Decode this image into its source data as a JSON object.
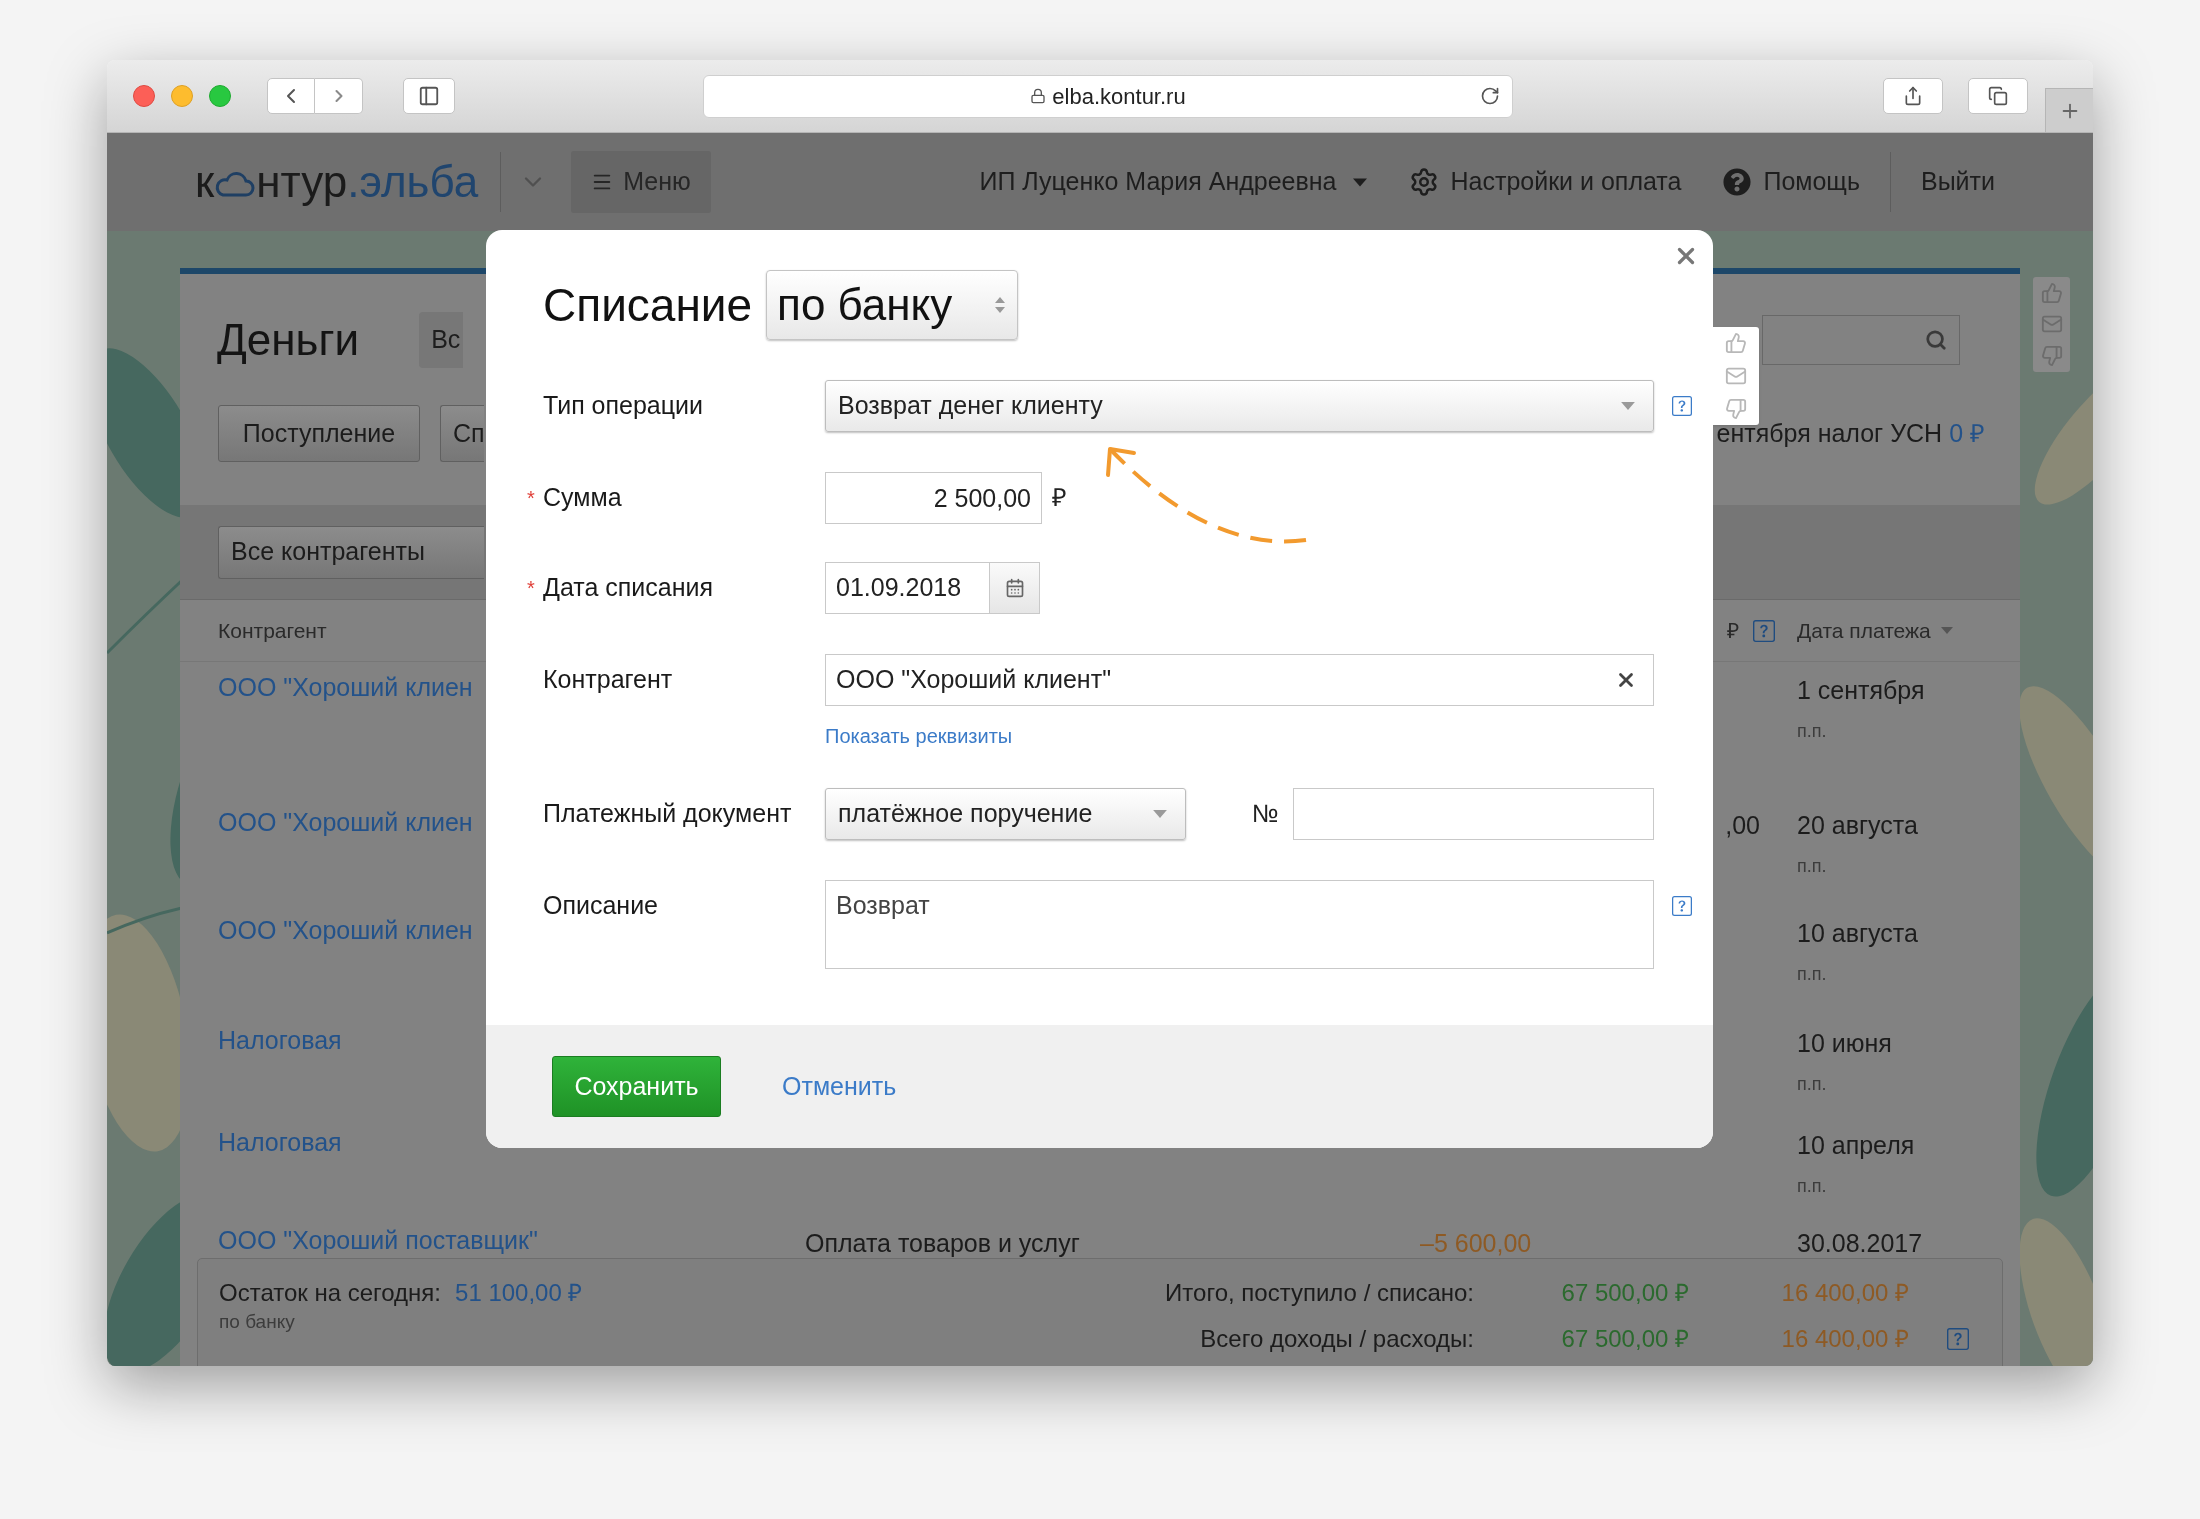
{
  "browser": {
    "url": "elba.kontur.ru"
  },
  "header": {
    "logo": {
      "first": "к",
      "middle": "нтур",
      "last": ".эльба"
    },
    "menu": "Меню",
    "user": "ИП Луценко Мария Андреевна",
    "settings": "Настройки и оплата",
    "help": "Помощь",
    "logout": "Выйти"
  },
  "page": {
    "title": "Деньги",
    "view_tab": "Вс",
    "buttons": [
      "Поступление",
      "Сп"
    ],
    "tax_note": {
      "text": "ентября налог УСН",
      "amount": "0 ₽"
    },
    "filter": "Все контрагенты",
    "table": {
      "columns": [
        {
          "label": "Контрагент",
          "help": false,
          "sorted": false
        },
        {
          "label": "₽",
          "help": true,
          "sorted": false
        },
        {
          "label": "Дата платежа",
          "help": false,
          "sorted": true
        }
      ],
      "rows": [
        {
          "contractor": "ООО \"Хороший клиен",
          "date": "1 сентября",
          "doc": "п.п."
        },
        {
          "contractor": "ООО \"Хороший клиен",
          "income": ",00",
          "date": "20 августа",
          "doc": "п.п."
        },
        {
          "contractor": "ООО \"Хороший клиен",
          "date": "10 августа",
          "doc": "п.п."
        },
        {
          "contractor": "Налоговая",
          "date": "10 июня",
          "doc": "п.п."
        },
        {
          "contractor": "Налоговая",
          "date": "10 апреля",
          "doc": "п.п."
        },
        {
          "contractor": "ООО \"Хороший поставщик\"",
          "purpose": "Оплата товаров и услуг",
          "expense": "–5 600,00",
          "date": "30.08.2017"
        }
      ]
    },
    "summary": {
      "balance_label": "Остаток на сегодня:",
      "balance": "51 100,00 ₽",
      "balance_note": "по банку",
      "totals": [
        {
          "label": "Итого, поступило / списано:",
          "income": "67 500,00 ₽",
          "expense": "16 400,00 ₽",
          "help": false
        },
        {
          "label": "Всего доходы / расходы:",
          "income": "67 500,00 ₽",
          "expense": "16 400,00 ₽",
          "help": true
        }
      ]
    }
  },
  "dialog": {
    "title": "Списание",
    "mode": "по банку",
    "required_mark": "*",
    "fields": [
      {
        "kind": "select",
        "label": "Тип операции",
        "value": "Возврат денег клиенту",
        "required": false,
        "help": true
      },
      {
        "kind": "amount",
        "label": "Сумма",
        "value": "2 500,00",
        "unit": "₽",
        "required": true,
        "help": false
      },
      {
        "kind": "date",
        "label": "Дата списания",
        "value": "01.09.2018",
        "required": true,
        "help": false
      },
      {
        "kind": "clearable",
        "label": "Контрагент",
        "value": "ООО \"Хороший клиент\"",
        "link": "Показать реквизиты",
        "required": false,
        "help": false
      },
      {
        "kind": "document",
        "label": "Платежный документ",
        "value": "платёжное поручение",
        "number_label": "№",
        "required": false,
        "help": false
      },
      {
        "kind": "textarea",
        "label": "Описание",
        "value": "Возврат",
        "required": false,
        "help": true
      }
    ],
    "save": "Сохранить",
    "cancel": "Отменить"
  }
}
